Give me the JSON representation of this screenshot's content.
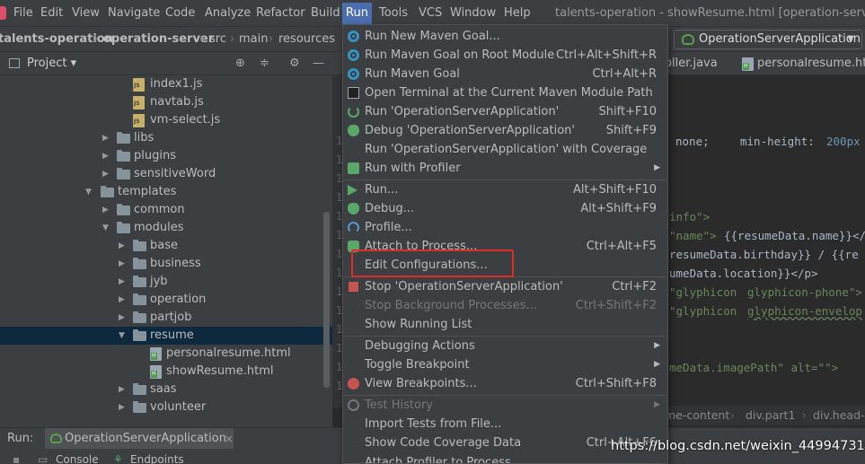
{
  "menubar": {
    "items": [
      "File",
      "Edit",
      "View",
      "Navigate",
      "Code",
      "Analyze",
      "Refactor",
      "Build",
      "Run",
      "Tools",
      "VCS",
      "Window",
      "Help"
    ],
    "active": "Run",
    "window_title": "talents-operation - showResume.html [operation-server] - .."
  },
  "navbar": {
    "crumbs": [
      "talents-operation",
      "operation-server",
      "src",
      "main",
      "resources"
    ],
    "run_config": "OperationServerApplication"
  },
  "project_panel": {
    "title": "Project",
    "tree": [
      {
        "label": "index1.js",
        "type": "js",
        "indent": 3
      },
      {
        "label": "navtab.js",
        "type": "js",
        "indent": 3
      },
      {
        "label": "vm-select.js",
        "type": "js",
        "indent": 3
      },
      {
        "label": "libs",
        "type": "folder",
        "indent": 2,
        "expanded": false
      },
      {
        "label": "plugins",
        "type": "folder",
        "indent": 2,
        "expanded": false
      },
      {
        "label": "sensitiveWord",
        "type": "folder",
        "indent": 2,
        "expanded": false
      },
      {
        "label": "templates",
        "type": "folder",
        "indent": 1,
        "expanded": true
      },
      {
        "label": "common",
        "type": "folder",
        "indent": 2,
        "expanded": false
      },
      {
        "label": "modules",
        "type": "folder",
        "indent": 2,
        "expanded": true
      },
      {
        "label": "base",
        "type": "folder",
        "indent": 3,
        "expanded": false
      },
      {
        "label": "business",
        "type": "folder",
        "indent": 3,
        "expanded": false
      },
      {
        "label": "jyb",
        "type": "folder",
        "indent": 3,
        "expanded": false
      },
      {
        "label": "operation",
        "type": "folder",
        "indent": 3,
        "expanded": false
      },
      {
        "label": "partjob",
        "type": "folder",
        "indent": 3,
        "expanded": false
      },
      {
        "label": "resume",
        "type": "folder",
        "indent": 3,
        "expanded": true,
        "selected": true
      },
      {
        "label": "personalresume.html",
        "type": "html",
        "indent": 4
      },
      {
        "label": "showResume.html",
        "type": "html",
        "indent": 4
      },
      {
        "label": "saas",
        "type": "folder",
        "indent": 3,
        "expanded": false
      },
      {
        "label": "volunteer",
        "type": "folder",
        "indent": 3,
        "expanded": false
      }
    ]
  },
  "editor": {
    "tabs": [
      "oller.java",
      "personalresume.htm"
    ],
    "gutter": [
      "1",
      "1",
      "1",
      "1",
      "1",
      "1",
      "1",
      "1",
      "1",
      "1",
      "1",
      "1",
      "1",
      "1"
    ],
    "code": {
      "line1_a": "none;",
      "line1_b": "min-height:",
      "line1_c": "200px",
      "line2": "info\">",
      "line3_a": "\"name\">",
      "line3_b": "{{resumeData.name}}</",
      "line4": "resumeData.birthday}} / {{re",
      "line5": "umeData.location}}</p>",
      "line6_a": "\"glyphicon",
      "line6_b": "glyphicon-phone\">",
      "line7_a": "\"glyphicon",
      "line7_b": "glyphicon-envelop",
      "line8_a": "meData.imagePath\" alt=\"\">"
    },
    "breadcrumbs": [
      "me-content",
      "div.part1",
      "div.head-a"
    ]
  },
  "run_menu": {
    "items": [
      {
        "label": "Run New Maven Goal...",
        "shortcut": "",
        "icon": "gear-icon"
      },
      {
        "label": "Run Maven Goal on Root Module",
        "shortcut": "Ctrl+Alt+Shift+R",
        "icon": "gear-icon"
      },
      {
        "label": "Run Maven Goal",
        "shortcut": "Ctrl+Alt+R",
        "icon": "gear-icon"
      },
      {
        "label": "Open Terminal at the Current Maven Module Path",
        "shortcut": "",
        "icon": "terminal-icon"
      },
      {
        "label": "Run 'OperationServerApplication'",
        "shortcut": "Shift+F10",
        "icon": "rerun-icon"
      },
      {
        "label": "Debug 'OperationServerApplication'",
        "shortcut": "Shift+F9",
        "icon": "bug-icon"
      },
      {
        "label": "Run 'OperationServerApplication' with Coverage",
        "shortcut": "",
        "icon": "coverage-icon"
      },
      {
        "label": "Run with Profiler",
        "shortcut": "",
        "icon": "profiler-run-icon",
        "submenu": true
      },
      {
        "label": "Run...",
        "shortcut": "Alt+Shift+F10",
        "icon": "play-icon"
      },
      {
        "label": "Debug...",
        "shortcut": "Alt+Shift+F9",
        "icon": "bug-icon"
      },
      {
        "label": "Profile...",
        "shortcut": "",
        "icon": "profile-icon"
      },
      {
        "label": "Attach to Process...",
        "shortcut": "Ctrl+Alt+F5",
        "icon": "attach-icon"
      },
      {
        "label": "Edit Configurations...",
        "shortcut": "",
        "icon": ""
      },
      {
        "label": "Stop 'OperationServerApplication'",
        "shortcut": "Ctrl+F2",
        "icon": "stop-icon"
      },
      {
        "label": "Stop Background Processes...",
        "shortcut": "Ctrl+Shift+F2",
        "icon": "",
        "disabled": true
      },
      {
        "label": "Show Running List",
        "shortcut": "",
        "icon": ""
      },
      {
        "label": "Debugging Actions",
        "shortcut": "",
        "icon": "",
        "submenu": true
      },
      {
        "label": "Toggle Breakpoint",
        "shortcut": "",
        "icon": "",
        "submenu": true
      },
      {
        "label": "View Breakpoints...",
        "shortcut": "Ctrl+Shift+F8",
        "icon": "breakpoint-icon"
      },
      {
        "label": "Test History",
        "shortcut": "",
        "icon": "history-icon",
        "disabled": true,
        "submenu": true
      },
      {
        "label": "Import Tests from File...",
        "shortcut": "",
        "icon": ""
      },
      {
        "label": "Show Code Coverage Data",
        "shortcut": "Ctrl+Alt+F6",
        "icon": ""
      },
      {
        "label": "Attach Profiler to Process",
        "shortcut": "",
        "icon": ""
      }
    ]
  },
  "run_panel": {
    "label": "Run:",
    "tab": "OperationServerApplication",
    "bottom_tabs": [
      "Console",
      "Endpoints"
    ]
  },
  "watermark": "https://blog.csdn.net/weixin_44994731",
  "colors": {
    "menu_active": "#4b6eaf",
    "highlight_box": "#e12b2b",
    "selection": "#0d293e"
  }
}
